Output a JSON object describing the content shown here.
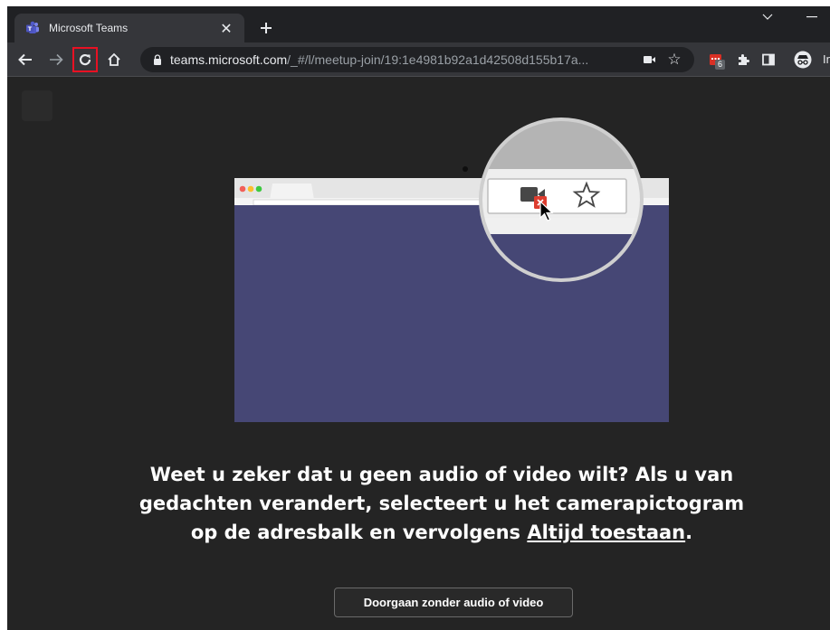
{
  "tab": {
    "title": "Microsoft Teams"
  },
  "toolbar": {
    "url_host": "teams.microsoft.com",
    "url_path": "/_#/l/meetup-join/19:1e4981b92a1d42508d155b17a...",
    "extension_badge": "6",
    "profile_label": "In"
  },
  "content": {
    "message_part1": "Weet u zeker dat u geen audio of video wilt? Als u van gedachten verandert, selecteert u het camerapictogram op de adresbalk en vervolgens ",
    "message_link": "Altijd toestaan",
    "message_part2": ".",
    "continue_button": "Doorgaan zonder audio of video"
  },
  "icons": {
    "favicon": "teams-icon",
    "reload": "reload-icon",
    "home": "home-icon",
    "back": "back-arrow-icon",
    "forward": "forward-arrow-icon",
    "camera_blocked": "camera-blocked-icon",
    "star": "bookmark-star-icon",
    "extensions": "puzzle-icon",
    "sidepanel": "side-panel-icon",
    "incognito": "incognito-icon"
  },
  "colors": {
    "frame_bg": "#202124",
    "toolbar_bg": "#35363a",
    "content_bg": "#242424",
    "browser_window_purple": "#464775",
    "highlight_red": "#e81123",
    "teams_purple": "#5059c9"
  }
}
